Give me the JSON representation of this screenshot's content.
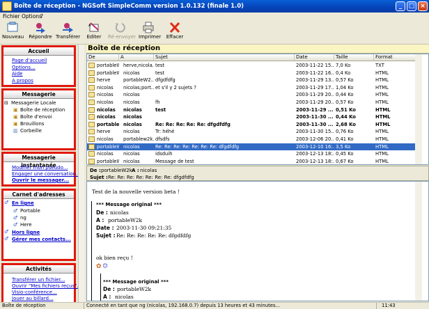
{
  "window": {
    "title": "Boîte de réception - NGSoft SimpleComm version 1.0.132 (finale 1.0)"
  },
  "menu": [
    "Fichier",
    "Options",
    "?"
  ],
  "toolbar": {
    "nouveau": "Nouveau",
    "repondre": "Répondre",
    "transferer": "Transférer",
    "editer": "Editer",
    "renvoyer": "Ré-envoyer",
    "imprimer": "Imprimer",
    "effacer": "Effacer"
  },
  "accueil": {
    "title": "Accueil",
    "links": [
      "Page d'accueil",
      "Options...",
      "Aide",
      "A propos"
    ]
  },
  "messagerie": {
    "title": "Messagerie",
    "root": "Messagerie Locale",
    "folders": [
      "Boîte de réception",
      "Boîte d'envoi",
      "Brouillons",
      "Corbeille"
    ]
  },
  "instantanee": {
    "title": "Messagerie instantanée",
    "links": [
      "Modifier mon pseudo...",
      "Engager une conversation...",
      "Ouvrir le messager..."
    ]
  },
  "carnet": {
    "title": "Carnet d'adresses",
    "online": "En ligne",
    "contacts": [
      "Portable",
      "ng",
      "Here"
    ],
    "offline": "Hors ligne",
    "manage": "Gérer mes contacts..."
  },
  "activites": {
    "title": "Activités",
    "links": [
      "Transférer un fichier...",
      "Ouvrir \"Mes fichiers reçus\"...",
      "Visio-conférence...",
      "Jouer au billard..."
    ]
  },
  "inbox": {
    "title": "Boîte de réception",
    "columns": [
      "De",
      "A",
      "Sujet",
      "Date",
      "Taille",
      "Format"
    ],
    "rows": [
      {
        "de": "portableW2k",
        "a": "herve,nicola...",
        "sujet": "test",
        "date": "2003-11-22 15...",
        "taille": "7,0 Ko",
        "format": "TXT",
        "bold": false,
        "sel": false
      },
      {
        "de": "portableW2k",
        "a": "nicolas",
        "sujet": "test",
        "date": "2003-11-22 16...",
        "taille": "0,4 Ko",
        "format": "HTML",
        "bold": false,
        "sel": false
      },
      {
        "de": "herve",
        "a": "portableW2...",
        "sujet": "dfgdfdfg",
        "date": "2003-11-29 13...",
        "taille": "0,57 Ko",
        "format": "HTML",
        "bold": false,
        "sel": false
      },
      {
        "de": "nicolas",
        "a": "nicolas;port...",
        "sujet": "et s'il y 2 sujets ?",
        "date": "2003-11-29 17...",
        "taille": "1,04 Ko",
        "format": "HTML",
        "bold": false,
        "sel": false
      },
      {
        "de": "nicolas",
        "a": "nicolas",
        "sujet": "",
        "date": "2003-11-29 20...",
        "taille": "0,44 Ko",
        "format": "HTML",
        "bold": false,
        "sel": false
      },
      {
        "de": "nicolas",
        "a": "nicolas",
        "sujet": "fh",
        "date": "2003-11-29 20...",
        "taille": "0,57 Ko",
        "format": "HTML",
        "bold": false,
        "sel": false
      },
      {
        "de": "nicolas",
        "a": "nicolas",
        "sujet": "test",
        "date": "2003-11-29 ...",
        "taille": "0,51 Ko",
        "format": "HTML",
        "bold": true,
        "sel": false
      },
      {
        "de": "nicolas",
        "a": "nicolas",
        "sujet": "",
        "date": "2003-11-30 ...",
        "taille": "0,44 Ko",
        "format": "HTML",
        "bold": true,
        "sel": false
      },
      {
        "de": "portable...",
        "a": "nicolas",
        "sujet": "Re: Re: Re: Re: Re: dfgdfdfg",
        "date": "2003-11-30 ...",
        "taille": "2,68 Ko",
        "format": "HTML",
        "bold": true,
        "sel": false
      },
      {
        "de": "herve",
        "a": "nicolas",
        "sujet": "Tr: héhé",
        "date": "2003-11-30 15...",
        "taille": "0,76 Ko",
        "format": "HTML",
        "bold": false,
        "sel": false
      },
      {
        "de": "nicolas",
        "a": "portablew2k...",
        "sujet": "dfsdfs",
        "date": "2003-12-06 20...",
        "taille": "0,41 Ko",
        "format": "HTML",
        "bold": false,
        "sel": false
      },
      {
        "de": "portableW...",
        "a": "nicolas",
        "sujet": "Re: Re: Re: Re: Re: Re: Re: dfgdfdfg",
        "date": "2003-12-10 16:...",
        "taille": "3,5 Ko",
        "format": "HTML",
        "bold": false,
        "sel": true
      },
      {
        "de": "nicolas",
        "a": "nicolas",
        "sujet": "idsduih",
        "date": "2003-12-13 18:...",
        "taille": "0,45 Ko",
        "format": "HTML",
        "bold": false,
        "sel": false
      },
      {
        "de": "portableW2...",
        "a": "nicolas",
        "sujet": "Message de test",
        "date": "2003-12-13 18:...",
        "taille": "0,67 Ko",
        "format": "HTML",
        "bold": false,
        "sel": false
      }
    ]
  },
  "preview": {
    "de_label": "De :",
    "de": "portableW2k",
    "a_label": "A :",
    "a": "nicolas",
    "sujet_label": "Sujet :",
    "sujet": "Re: Re: Re: Re: Re: Re: Re: dfgdfdfg"
  },
  "body": {
    "intro": "Test de la nouvelle version beta !",
    "orig1_title": "*** Message original ***",
    "orig1_de_label": "De :",
    "orig1_de": "nicolas",
    "orig1_a_label": "A :",
    "orig1_a": "portableW2k",
    "orig1_date_label": "Date :",
    "orig1_date": "2003-11-30 09:21:35",
    "orig1_sujet_label": "Sujet :",
    "orig1_sujet": "Re: Re: Re: Re: Re: dfgdfdfg",
    "reply": "ok bien reçu !",
    "orig2_title": "*** Message original ***",
    "orig2_de_label": "De :",
    "orig2_de": "portableW2k",
    "orig2_a_label": "A :",
    "orig2_a": "nicolas"
  },
  "status": {
    "folder": "Boîte de réception",
    "connection": "Connecté en tant que ng (nicolas, 192.168.0.7) depuis 13 heures et 43 minutes...",
    "time": "11:43"
  }
}
